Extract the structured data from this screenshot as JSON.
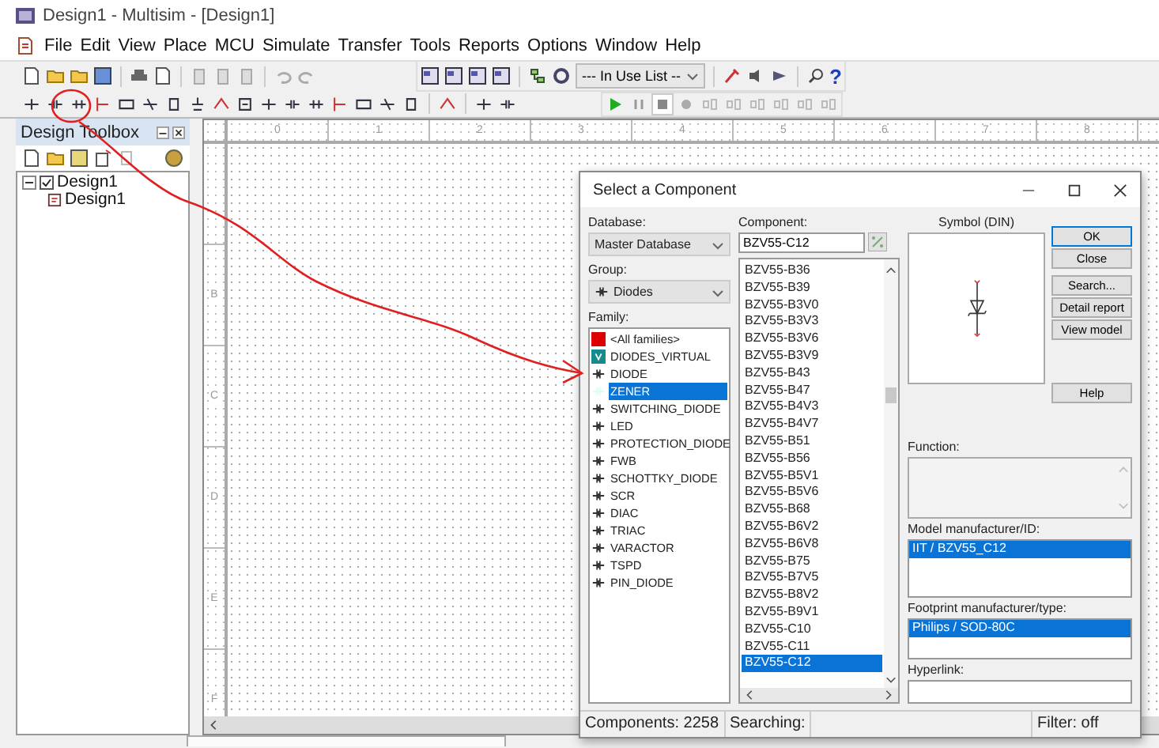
{
  "window": {
    "title": "Design1 - Multisim - [Design1]"
  },
  "menu": [
    "File",
    "Edit",
    "View",
    "Place",
    "MCU",
    "Simulate",
    "Transfer",
    "Tools",
    "Reports",
    "Options",
    "Window",
    "Help"
  ],
  "toolbar": {
    "in_use_list": "--- In Use List --",
    "help_glyph": "?"
  },
  "design_toolbox": {
    "title": "Design Toolbox",
    "tree": [
      {
        "label": "Design1",
        "checked": true,
        "expanded": true,
        "children": [
          {
            "label": "Design1"
          }
        ]
      }
    ]
  },
  "ruler": {
    "top_labels": [
      "0",
      "1",
      "2",
      "3",
      "4",
      "5",
      "6",
      "7",
      "8"
    ],
    "left_labels": [
      "B",
      "C",
      "D",
      "E",
      "F"
    ]
  },
  "dialog": {
    "title": "Select a Component",
    "database_label": "Database:",
    "database": "Master Database",
    "group_label": "Group:",
    "group": "Diodes",
    "family_label": "Family:",
    "families": [
      {
        "label": "<All families>",
        "selected": false
      },
      {
        "label": "DIODES_VIRTUAL",
        "selected": false
      },
      {
        "label": "DIODE",
        "selected": false
      },
      {
        "label": "ZENER",
        "selected": true
      },
      {
        "label": "SWITCHING_DIODE",
        "selected": false
      },
      {
        "label": "LED",
        "selected": false
      },
      {
        "label": "PROTECTION_DIODE",
        "selected": false
      },
      {
        "label": "FWB",
        "selected": false
      },
      {
        "label": "SCHOTTKY_DIODE",
        "selected": false
      },
      {
        "label": "SCR",
        "selected": false
      },
      {
        "label": "DIAC",
        "selected": false
      },
      {
        "label": "TRIAC",
        "selected": false
      },
      {
        "label": "VARACTOR",
        "selected": false
      },
      {
        "label": "TSPD",
        "selected": false
      },
      {
        "label": "PIN_DIODE",
        "selected": false
      }
    ],
    "component_label": "Component:",
    "component": "BZV55-C12",
    "components": [
      {
        "label": "BZV55-B36",
        "selected": false
      },
      {
        "label": "BZV55-B39",
        "selected": false
      },
      {
        "label": "BZV55-B3V0",
        "selected": false
      },
      {
        "label": "BZV55-B3V3",
        "selected": false
      },
      {
        "label": "BZV55-B3V6",
        "selected": false
      },
      {
        "label": "BZV55-B3V9",
        "selected": false
      },
      {
        "label": "BZV55-B43",
        "selected": false
      },
      {
        "label": "BZV55-B47",
        "selected": false
      },
      {
        "label": "BZV55-B4V3",
        "selected": false
      },
      {
        "label": "BZV55-B4V7",
        "selected": false
      },
      {
        "label": "BZV55-B51",
        "selected": false
      },
      {
        "label": "BZV55-B56",
        "selected": false
      },
      {
        "label": "BZV55-B5V1",
        "selected": false
      },
      {
        "label": "BZV55-B5V6",
        "selected": false
      },
      {
        "label": "BZV55-B68",
        "selected": false
      },
      {
        "label": "BZV55-B6V2",
        "selected": false
      },
      {
        "label": "BZV55-B6V8",
        "selected": false
      },
      {
        "label": "BZV55-B75",
        "selected": false
      },
      {
        "label": "BZV55-B7V5",
        "selected": false
      },
      {
        "label": "BZV55-B8V2",
        "selected": false
      },
      {
        "label": "BZV55-B9V1",
        "selected": false
      },
      {
        "label": "BZV55-C10",
        "selected": false
      },
      {
        "label": "BZV55-C11",
        "selected": false
      },
      {
        "label": "BZV55-C12",
        "selected": true
      }
    ],
    "symbol_label": "Symbol (DIN)",
    "buttons": [
      "OK",
      "Close",
      "Search...",
      "Detail report",
      "View model",
      "Help"
    ],
    "function_label": "Function:",
    "model_label": "Model manufacturer/ID:",
    "models": [
      {
        "label": "IIT / BZV55_C12",
        "selected": true
      }
    ],
    "footprint_label": "Footprint manufacturer/type:",
    "footprints": [
      {
        "label": "Philips / SOD-80C",
        "selected": true
      }
    ],
    "hyperlink_label": "Hyperlink:",
    "status": {
      "components": "Components: 2258",
      "searching": "Searching:",
      "filter": "Filter: off"
    }
  }
}
